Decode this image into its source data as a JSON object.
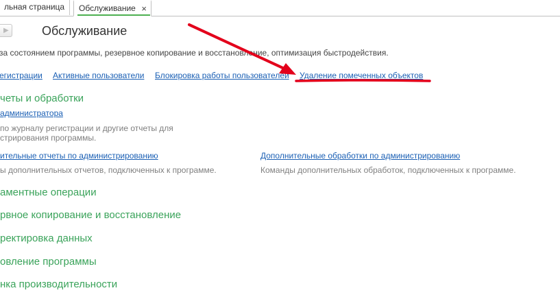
{
  "tabs": {
    "tab1_label": "льная страница",
    "tab2_label": "Обслуживание",
    "close_glyph": "×"
  },
  "header": {
    "title": "Обслуживание",
    "nav_glyph": "▶"
  },
  "description": " за состоянием программы, резервное копирование и восстановление, оптимизация быстродействия.",
  "top_links": {
    "registration": "егистрации",
    "active_users": "Активные пользователи",
    "block_users": "Блокировка работы пользователей",
    "delete_marked": "Удаление помеченных объектов"
  },
  "sections": {
    "reports": {
      "heading": "четы и обработки",
      "admin_link": "администратора",
      "admin_desc_line1": " по журналу регистрации и другие отчеты для",
      "admin_desc_line2": "стрирования программы.",
      "extra_reports_link": "ительные отчеты по администрированию",
      "extra_reports_desc": "ы дополнительных отчетов, подключенных к программе.",
      "extra_processing_link": "Дополнительные обработки по администрированию",
      "extra_processing_desc": "Команды дополнительных обработок, подключенных к программе."
    },
    "regulatory": "аментные операции",
    "backup": "рвное копирование и восстановление",
    "data_correction": "ректировка данных",
    "update": "овление программы",
    "performance": "нка производительности"
  },
  "colors": {
    "link": "#1a5fb4",
    "section_heading": "#3aa35a",
    "annotation_red": "#e3001b",
    "active_tab_underline": "#4caf50"
  }
}
